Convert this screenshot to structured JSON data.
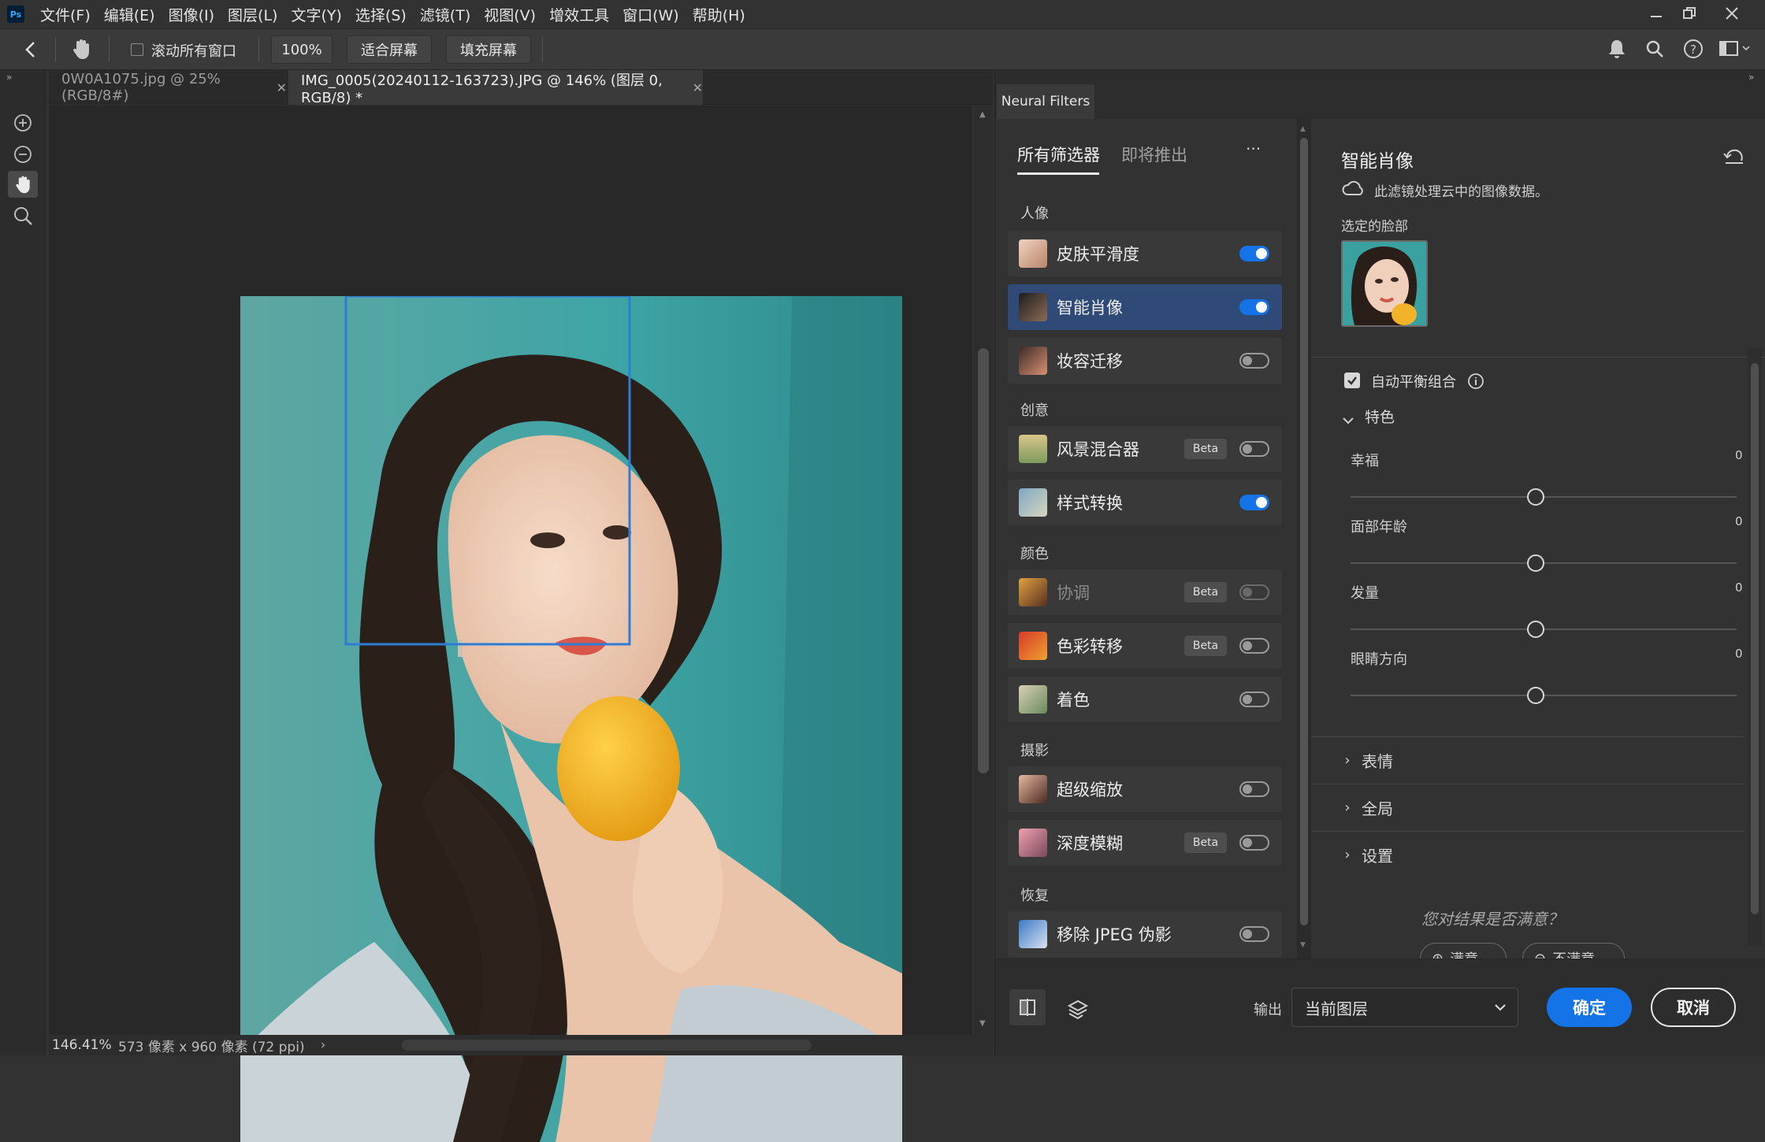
{
  "menubar": {
    "logo": "Ps",
    "items": [
      "文件(F)",
      "编辑(E)",
      "图像(I)",
      "图层(L)",
      "文字(Y)",
      "选择(S)",
      "滤镜(T)",
      "视图(V)",
      "增效工具",
      "窗口(W)",
      "帮助(H)"
    ]
  },
  "options": {
    "scroll_all_label": "滚动所有窗口",
    "zoom_value": "100%",
    "fit_screen": "适合屏幕",
    "fill_screen": "填充屏幕"
  },
  "doc_tabs": [
    {
      "label": "0W0A1075.jpg @ 25%(RGB/8#)"
    },
    {
      "label": "IMG_0005(20240112-163723).JPG @ 146% (图层 0, RGB/8) *"
    }
  ],
  "status": {
    "zoom": "146.41%",
    "doc_info": "573 像素 x 960 像素 (72 ppi)"
  },
  "neural": {
    "panel_tab": "Neural Filters",
    "tabs": [
      "所有筛选器",
      "即将推出"
    ],
    "more": "···",
    "groups": [
      {
        "label": "人像",
        "filters": [
          {
            "label": "皮肤平滑度",
            "state": "on",
            "selected": false,
            "beta": "",
            "dim": false
          },
          {
            "label": "智能肖像",
            "state": "on",
            "selected": true,
            "beta": "",
            "dim": false
          },
          {
            "label": "妆容迁移",
            "state": "off",
            "selected": false,
            "beta": "",
            "dim": false
          }
        ]
      },
      {
        "label": "创意",
        "filters": [
          {
            "label": "风景混合器",
            "state": "off",
            "selected": false,
            "beta": "Beta",
            "dim": false
          },
          {
            "label": "样式转换",
            "state": "on",
            "selected": false,
            "beta": "",
            "dim": false
          }
        ]
      },
      {
        "label": "颜色",
        "filters": [
          {
            "label": "协调",
            "state": "off",
            "selected": false,
            "beta": "Beta",
            "dim": true
          },
          {
            "label": "色彩转移",
            "state": "off",
            "selected": false,
            "beta": "Beta",
            "dim": false
          },
          {
            "label": "着色",
            "state": "off",
            "selected": false,
            "beta": "",
            "dim": false
          }
        ]
      },
      {
        "label": "摄影",
        "filters": [
          {
            "label": "超级缩放",
            "state": "off",
            "selected": false,
            "beta": "",
            "dim": false
          },
          {
            "label": "深度模糊",
            "state": "off",
            "selected": false,
            "beta": "Beta",
            "dim": false
          }
        ]
      },
      {
        "label": "恢复",
        "filters": [
          {
            "label": "移除 JPEG 伪影",
            "state": "off",
            "selected": false,
            "beta": "",
            "dim": false
          }
        ]
      }
    ],
    "detail": {
      "title": "智能肖像",
      "cloud_note": "此滤镜处理云中的图像数据。",
      "selected_face_label": "选定的脸部",
      "auto_balance_label": "自动平衡组合",
      "auto_balance_checked": true,
      "section_features": "特色",
      "sliders": [
        {
          "label": "幸福",
          "value": "0"
        },
        {
          "label": "面部年龄",
          "value": "0"
        },
        {
          "label": "发量",
          "value": "0"
        },
        {
          "label": "眼睛方向",
          "value": "0"
        }
      ],
      "expanders": [
        "表情",
        "全局",
        "设置"
      ],
      "feedback_question": "您对结果是否满意？",
      "feedback_yes": "满意",
      "feedback_no": "不满意"
    },
    "bottom": {
      "output_label": "输出",
      "output_value": "当前图层",
      "ok": "确定",
      "cancel": "取消"
    }
  }
}
